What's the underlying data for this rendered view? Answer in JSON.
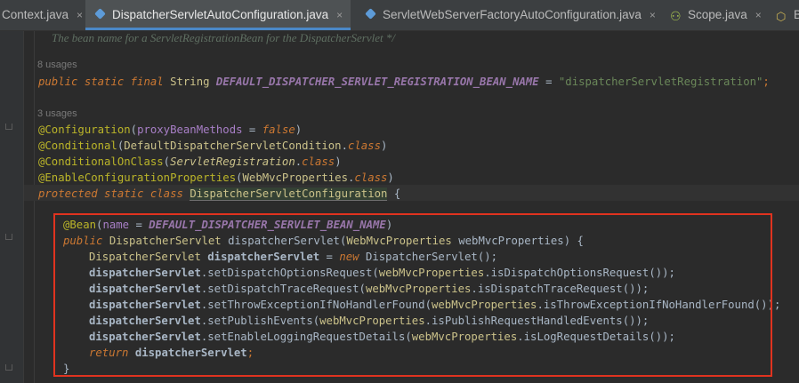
{
  "tabs": [
    {
      "label": "Context.java",
      "icon": "java-class-icon",
      "active": false
    },
    {
      "label": "DispatcherServletAutoConfiguration.java",
      "icon": "java-class-icon",
      "active": true
    },
    {
      "label": "ServletWebServerFactoryAutoConfiguration.java",
      "icon": "java-class-icon",
      "active": false
    },
    {
      "label": "Scope.java",
      "icon": "annotation-icon",
      "active": false
    },
    {
      "label": "B",
      "icon": "package-icon",
      "active": false
    }
  ],
  "close_glyph": "×",
  "top_comment": "The bean name for a ServletRegistrationBean for the DispatcherServlet */",
  "usages": [
    "8 usages",
    "3 usages"
  ],
  "code": {
    "l1": {
      "public": "public",
      "static": "static",
      "final": "final",
      "string": "String",
      "constant": "DEFAULT_DISPATCHER_SERVLET_REGISTRATION_BEAN_NAME",
      "eq": " = ",
      "value": "\"dispatcherServletRegistration\"",
      "semi": ";"
    },
    "l2": {
      "ann": "@Configuration",
      "open": "(",
      "param": "proxyBeanMethods",
      "eq": " = ",
      "val": "false",
      "close": ")"
    },
    "l3": {
      "ann": "@Conditional",
      "open": "(",
      "cls": "DefaultDispatcherServletCondition",
      "dot": ".",
      "kw": "class",
      "close": ")"
    },
    "l4": {
      "ann": "@ConditionalOnClass",
      "open": "(",
      "cls": "ServletRegistration",
      "dot": ".",
      "kw": "class",
      "close": ")"
    },
    "l5": {
      "ann": "@EnableConfigurationProperties",
      "open": "(",
      "cls": "WebMvcProperties",
      "dot": ".",
      "kw": "class",
      "close": ")"
    },
    "l6": {
      "protected": "protected",
      "static": "static",
      "class": "class",
      "name": "DispatcherServletConfiguration",
      "brace": " {"
    },
    "l7": {
      "ann": "@Bean",
      "open": "(",
      "param": "name",
      "eq": " = ",
      "constant": "DEFAULT_DISPATCHER_SERVLET_BEAN_NAME",
      "close": ")"
    },
    "l8": {
      "public": "public",
      "type": "DispatcherServlet",
      "method": "dispatcherServlet",
      "open": "(",
      "ptype": "WebMvcProperties",
      "pname": "webMvcProperties",
      "close": ") {"
    },
    "l9": {
      "type": "DispatcherServlet",
      "var": "dispatcherServlet",
      "eq": " = ",
      "new": "new",
      "ctor": "DispatcherServlet",
      "end": "();"
    },
    "l10": {
      "var": "dispatcherServlet",
      "dot": ".",
      "setter": "setDispatchOptionsRequest",
      "open": "(",
      "arg": "webMvcProperties",
      "dot2": ".",
      "getter": "isDispatchOptionsRequest",
      "end": "());"
    },
    "l11": {
      "var": "dispatcherServlet",
      "dot": ".",
      "setter": "setDispatchTraceRequest",
      "open": "(",
      "arg": "webMvcProperties",
      "dot2": ".",
      "getter": "isDispatchTraceRequest",
      "end": "());"
    },
    "l12": {
      "var": "dispatcherServlet",
      "dot": ".",
      "setter": "setThrowExceptionIfNoHandlerFound",
      "open": "(",
      "arg": "webMvcProperties",
      "dot2": ".",
      "getter": "isThrowExceptionIfNoHandlerFound",
      "end": "());"
    },
    "l13": {
      "var": "dispatcherServlet",
      "dot": ".",
      "setter": "setPublishEvents",
      "open": "(",
      "arg": "webMvcProperties",
      "dot2": ".",
      "getter": "isPublishRequestHandledEvents",
      "end": "());"
    },
    "l14": {
      "var": "dispatcherServlet",
      "dot": ".",
      "setter": "setEnableLoggingRequestDetails",
      "open": "(",
      "arg": "webMvcProperties",
      "dot2": ".",
      "getter": "isLogRequestDetails",
      "end": "());"
    },
    "l15": {
      "return": "return",
      "var": "dispatcherServlet",
      "semi": ";"
    },
    "l16": {
      "brace": "}"
    }
  },
  "colors": {
    "keyword": "#cc7832",
    "annotation": "#bbb529",
    "string": "#6a8759",
    "constant": "#9876aa",
    "highlight_box": "#e0331f",
    "active_tab_underline": "#4a88c7"
  }
}
